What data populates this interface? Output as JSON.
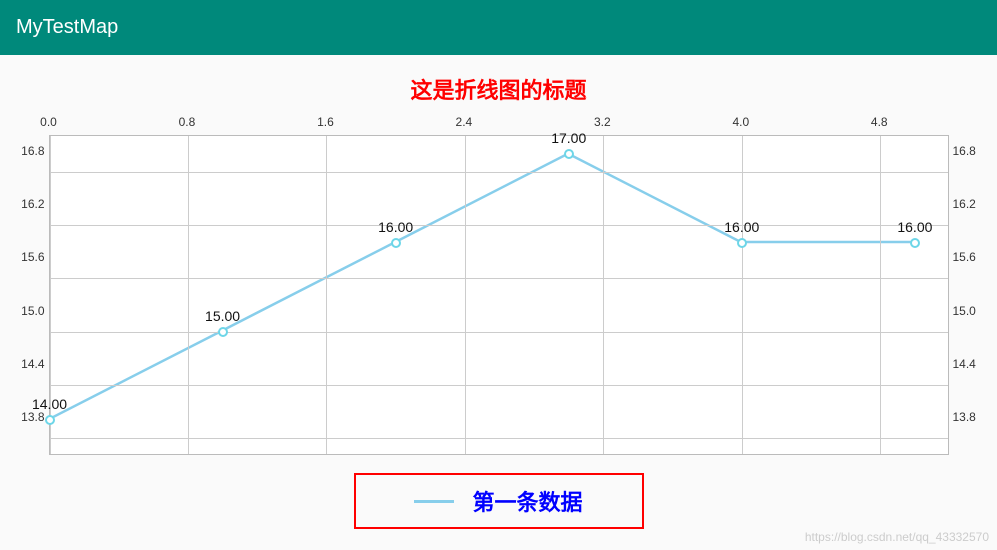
{
  "app_bar": {
    "title": "MyTestMap"
  },
  "chart_data": {
    "type": "line",
    "title": "这是折线图的标题",
    "x": [
      0,
      1,
      2,
      3,
      4,
      5
    ],
    "values": [
      14.0,
      15.0,
      16.0,
      17.0,
      16.0,
      16.0
    ],
    "value_labels": [
      "14.00",
      "15.00",
      "16.00",
      "17.00",
      "16.00",
      "16.00"
    ],
    "x_ticks": [
      "0.0",
      "0.8",
      "1.6",
      "2.4",
      "3.2",
      "4.0",
      "4.8"
    ],
    "x_tick_values": [
      0.0,
      0.8,
      1.6,
      2.4,
      3.2,
      4.0,
      4.8
    ],
    "y_ticks": [
      "13.8",
      "14.4",
      "15.0",
      "15.6",
      "16.2",
      "16.8"
    ],
    "y_tick_values": [
      13.8,
      14.4,
      15.0,
      15.6,
      16.2,
      16.8
    ],
    "y_ticks_right": [
      "13.8",
      "14.4",
      "15.0",
      "15.6",
      "16.2",
      "16.8"
    ],
    "xlim": [
      0,
      5.2
    ],
    "ylim": [
      13.6,
      17.2
    ],
    "legend": [
      "第一条数据"
    ],
    "line_color": "#87ceeb",
    "grid": true
  },
  "watermark": "https://blog.csdn.net/qq_43332570"
}
